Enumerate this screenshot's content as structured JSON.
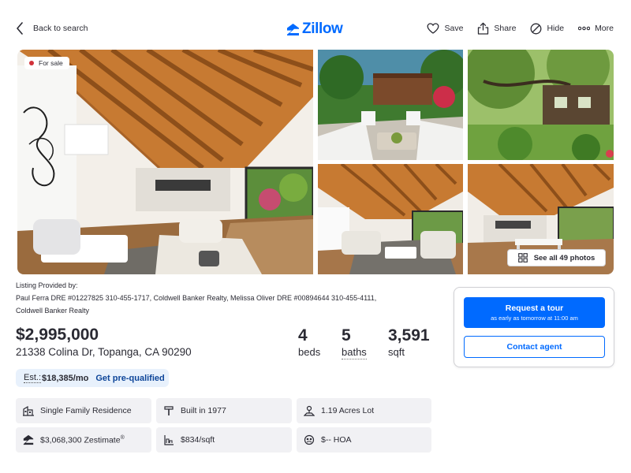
{
  "header": {
    "back_label": "Back to search",
    "logo_text": "Zillow",
    "actions": [
      {
        "label": "Save",
        "icon": "heart-icon"
      },
      {
        "label": "Share",
        "icon": "share-icon"
      },
      {
        "label": "Hide",
        "icon": "hide-icon"
      },
      {
        "label": "More",
        "icon": "more-icon"
      }
    ]
  },
  "gallery": {
    "badge": "For sale",
    "see_all": "See all 49 photos"
  },
  "listing": {
    "provided_title": "Listing Provided by:",
    "provided_line1": "Paul Ferra DRE #01227825 310-455-1717, Coldwell Banker Realty, Melissa Oliver DRE #00894644 310-455-4111,",
    "provided_line2": "Coldwell Banker Realty",
    "price": "$2,995,000",
    "address": "21338 Colina Dr, Topanga, CA 90290",
    "beds_num": "4",
    "beds_unit": "beds",
    "baths_num": "5",
    "baths_unit": "baths",
    "sqft_num": "3,591",
    "sqft_unit": "sqft",
    "est_label": "Est.:",
    "est_value": "$18,385/mo",
    "prequal": "Get pre-qualified"
  },
  "tiles": {
    "type": "Single Family Residence",
    "built": "Built in 1977",
    "lot": "1.19 Acres Lot",
    "zestimate": "$3,068,300 Zestimate",
    "zestimate_reg": "®",
    "ppsqft": "$834/sqft",
    "hoa": "$-- HOA"
  },
  "contact": {
    "tour_label": "Request a tour",
    "tour_sub": "as early as tomorrow at 11:00 am",
    "agent_label": "Contact agent"
  },
  "colors": {
    "brand": "#006aff",
    "badge_dot": "#d1323a",
    "est_bg": "#e8f1fc",
    "tile_bg": "#f1f1f4"
  }
}
